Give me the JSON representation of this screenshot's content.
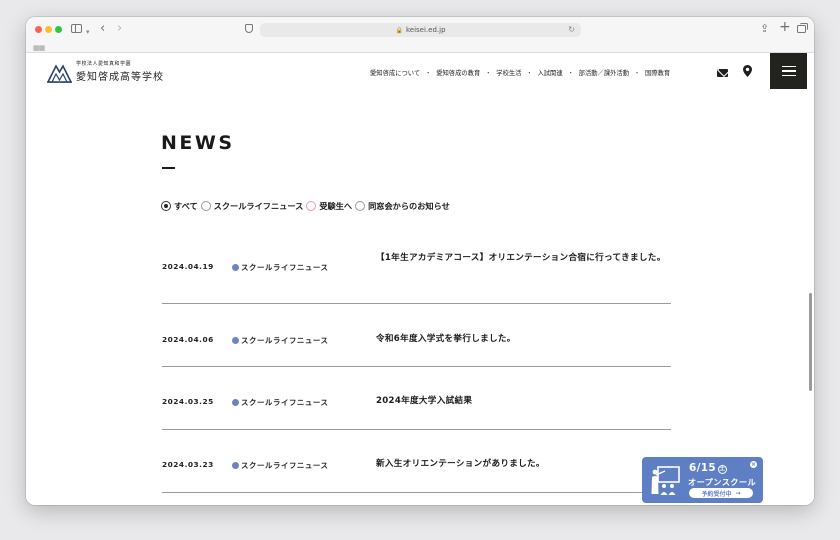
{
  "browser": {
    "url": "keisei.ed.jp"
  },
  "header": {
    "logo_sub": "学校法人愛知真和学園",
    "logo_main": "愛知啓成高等学校",
    "nav": [
      "愛知啓成について",
      "愛知啓成の教育",
      "学校生活",
      "入試関連",
      "部活動／課外活動",
      "国際教育"
    ],
    "nav_separator": "・"
  },
  "news": {
    "heading": "NEWS",
    "filters": [
      {
        "label": "すべて",
        "checked": true,
        "color": "#333333"
      },
      {
        "label": "スクールライフニュース",
        "checked": false,
        "color": "#999999"
      },
      {
        "label": "受験生へ",
        "checked": false,
        "color": "#e79ab2"
      },
      {
        "label": "同窓会からのお知らせ",
        "checked": false,
        "color": "#999999"
      }
    ],
    "items": [
      {
        "date": "2024.04.19",
        "category": "スクールライフニュース",
        "title": "【1年生アカデミアコース】オリエンテーション合宿に行ってきました。"
      },
      {
        "date": "2024.04.06",
        "category": "スクールライフニュース",
        "title": "令和6年度入学式を挙行しました。"
      },
      {
        "date": "2024.03.25",
        "category": "スクールライフニュース",
        "title": "2024年度大学入試結果"
      },
      {
        "date": "2024.03.23",
        "category": "スクールライフニュース",
        "title": "新入生オリエンテーションがありました。"
      }
    ]
  },
  "banner": {
    "date": "6/15",
    "weekday": "土",
    "label": "オープンスクール",
    "pill": "予約受付中",
    "arrow": "→",
    "close": "×",
    "color": "#5f7fc4"
  },
  "colors": {
    "accent_dark": "#22221e",
    "category_dot": "#6f83bf"
  }
}
